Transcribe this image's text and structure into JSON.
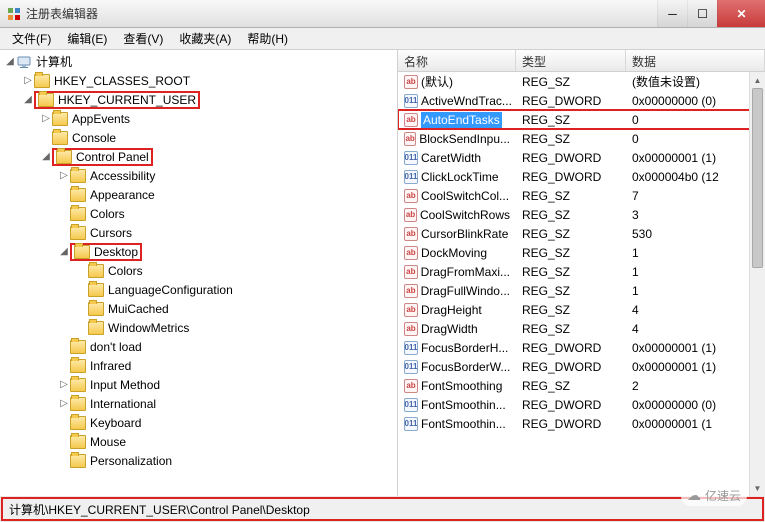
{
  "window": {
    "title": "注册表编辑器"
  },
  "menu": {
    "file": "文件(F)",
    "edit": "编辑(E)",
    "view": "查看(V)",
    "favorites": "收藏夹(A)",
    "help": "帮助(H)"
  },
  "tree": {
    "root": "计算机",
    "items": [
      {
        "indent": 1,
        "exp": "▷",
        "label": "HKEY_CLASSES_ROOT"
      },
      {
        "indent": 1,
        "exp": "◢",
        "label": "HKEY_CURRENT_USER",
        "boxed": true
      },
      {
        "indent": 2,
        "exp": "▷",
        "label": "AppEvents"
      },
      {
        "indent": 2,
        "exp": "",
        "label": "Console"
      },
      {
        "indent": 2,
        "exp": "◢",
        "label": "Control Panel",
        "boxed": true
      },
      {
        "indent": 3,
        "exp": "▷",
        "label": "Accessibility"
      },
      {
        "indent": 3,
        "exp": "",
        "label": "Appearance"
      },
      {
        "indent": 3,
        "exp": "",
        "label": "Colors"
      },
      {
        "indent": 3,
        "exp": "",
        "label": "Cursors"
      },
      {
        "indent": 3,
        "exp": "◢",
        "label": "Desktop",
        "boxed": true
      },
      {
        "indent": 4,
        "exp": "",
        "label": "Colors"
      },
      {
        "indent": 4,
        "exp": "",
        "label": "LanguageConfiguration"
      },
      {
        "indent": 4,
        "exp": "",
        "label": "MuiCached"
      },
      {
        "indent": 4,
        "exp": "",
        "label": "WindowMetrics"
      },
      {
        "indent": 3,
        "exp": "",
        "label": "don't load"
      },
      {
        "indent": 3,
        "exp": "",
        "label": "Infrared"
      },
      {
        "indent": 3,
        "exp": "▷",
        "label": "Input Method"
      },
      {
        "indent": 3,
        "exp": "▷",
        "label": "International"
      },
      {
        "indent": 3,
        "exp": "",
        "label": "Keyboard"
      },
      {
        "indent": 3,
        "exp": "",
        "label": "Mouse"
      },
      {
        "indent": 3,
        "exp": "",
        "label": "Personalization"
      }
    ]
  },
  "list": {
    "headers": {
      "name": "名称",
      "type": "类型",
      "data": "数据"
    },
    "rows": [
      {
        "icon": "sz",
        "name": "(默认)",
        "type": "REG_SZ",
        "data": "(数值未设置)"
      },
      {
        "icon": "dw",
        "name": "ActiveWndTrac...",
        "type": "REG_DWORD",
        "data": "0x00000000 (0)"
      },
      {
        "icon": "sz",
        "name": "AutoEndTasks",
        "type": "REG_SZ",
        "data": "0",
        "selected": true,
        "boxed": true
      },
      {
        "icon": "sz",
        "name": "BlockSendInpu...",
        "type": "REG_SZ",
        "data": "0"
      },
      {
        "icon": "dw",
        "name": "CaretWidth",
        "type": "REG_DWORD",
        "data": "0x00000001 (1)"
      },
      {
        "icon": "dw",
        "name": "ClickLockTime",
        "type": "REG_DWORD",
        "data": "0x000004b0 (12"
      },
      {
        "icon": "sz",
        "name": "CoolSwitchCol...",
        "type": "REG_SZ",
        "data": "7"
      },
      {
        "icon": "sz",
        "name": "CoolSwitchRows",
        "type": "REG_SZ",
        "data": "3"
      },
      {
        "icon": "sz",
        "name": "CursorBlinkRate",
        "type": "REG_SZ",
        "data": "530"
      },
      {
        "icon": "sz",
        "name": "DockMoving",
        "type": "REG_SZ",
        "data": "1"
      },
      {
        "icon": "sz",
        "name": "DragFromMaxi...",
        "type": "REG_SZ",
        "data": "1"
      },
      {
        "icon": "sz",
        "name": "DragFullWindo...",
        "type": "REG_SZ",
        "data": "1"
      },
      {
        "icon": "sz",
        "name": "DragHeight",
        "type": "REG_SZ",
        "data": "4"
      },
      {
        "icon": "sz",
        "name": "DragWidth",
        "type": "REG_SZ",
        "data": "4"
      },
      {
        "icon": "dw",
        "name": "FocusBorderH...",
        "type": "REG_DWORD",
        "data": "0x00000001 (1)"
      },
      {
        "icon": "dw",
        "name": "FocusBorderW...",
        "type": "REG_DWORD",
        "data": "0x00000001 (1)"
      },
      {
        "icon": "sz",
        "name": "FontSmoothing",
        "type": "REG_SZ",
        "data": "2"
      },
      {
        "icon": "dw",
        "name": "FontSmoothin...",
        "type": "REG_DWORD",
        "data": "0x00000000 (0)"
      },
      {
        "icon": "dw",
        "name": "FontSmoothin...",
        "type": "REG_DWORD",
        "data": "0x00000001 (1"
      }
    ]
  },
  "statusbar": {
    "path": "计算机\\HKEY_CURRENT_USER\\Control Panel\\Desktop"
  },
  "watermark": {
    "text": "亿速云"
  },
  "icons": {
    "ab": "ab",
    "nums": "011"
  }
}
